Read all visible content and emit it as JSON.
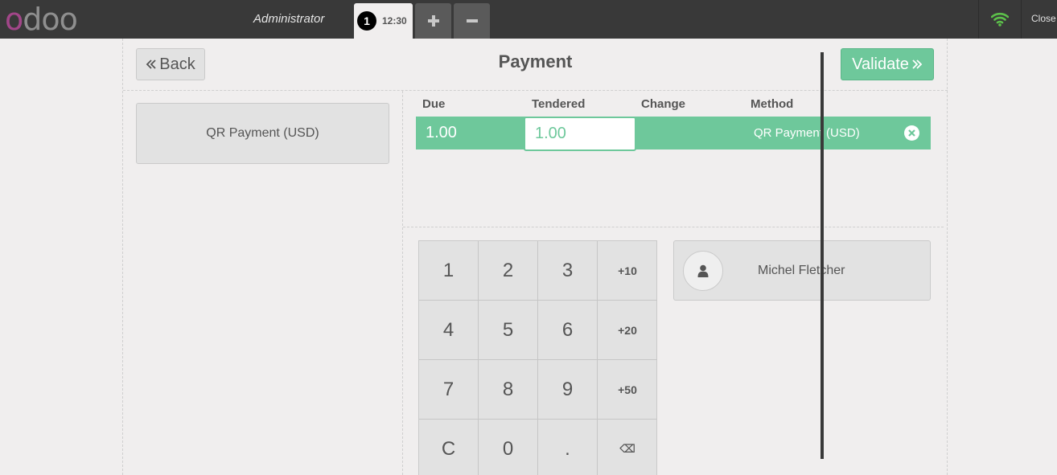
{
  "topbar": {
    "logo": {
      "letters": [
        "o",
        "d",
        "o",
        "o"
      ],
      "colors": [
        "#a24689",
        "#8f8f8f",
        "#8f8f8f",
        "#8f8f8f"
      ]
    },
    "user": "Administrator",
    "order_tab": {
      "number": "1",
      "time": "12:30"
    },
    "add_icon": "plus-icon",
    "remove_icon": "minus-icon",
    "wifi_icon": "wifi-icon",
    "wifi_color": "#5cc04a",
    "close_label": "Close"
  },
  "header": {
    "back_label": "Back",
    "title": "Payment",
    "validate_label": "Validate"
  },
  "payment_methods": [
    {
      "label": "QR Payment (USD)"
    }
  ],
  "paymentlines": {
    "columns": [
      "Due",
      "Tendered",
      "Change",
      "Method"
    ],
    "rows": [
      {
        "due": "1.00",
        "tendered": "1.00",
        "change": "",
        "method": "QR Payment (USD)"
      }
    ]
  },
  "numpad": {
    "keys": [
      "1",
      "2",
      "3",
      "+10",
      "4",
      "5",
      "6",
      "+20",
      "7",
      "8",
      "9",
      "+50",
      "C",
      "0",
      ".",
      "⌫"
    ]
  },
  "customer": {
    "name": "Michel Fletcher",
    "icon": "user-icon"
  },
  "colors": {
    "accent": "#6ec89b",
    "topbar": "#393939",
    "background": "#f0eeee"
  }
}
